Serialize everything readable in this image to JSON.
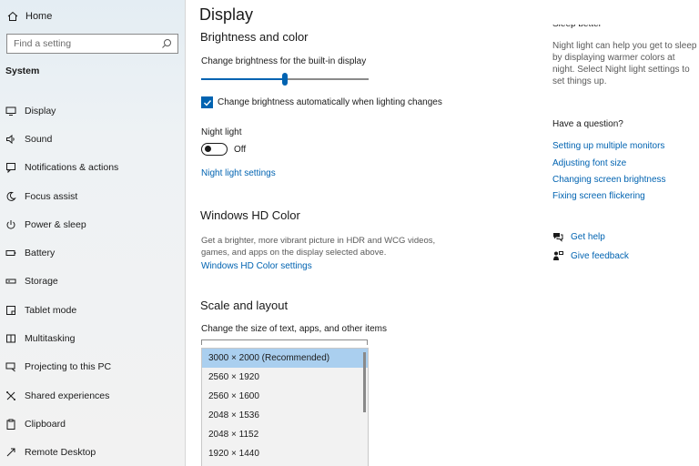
{
  "sidebar": {
    "home_label": "Home",
    "search_placeholder": "Find a setting",
    "section_title": "System",
    "items": [
      {
        "label": "Display",
        "icon": "monitor-icon"
      },
      {
        "label": "Sound",
        "icon": "speaker-icon"
      },
      {
        "label": "Notifications & actions",
        "icon": "notification-icon"
      },
      {
        "label": "Focus assist",
        "icon": "moon-icon"
      },
      {
        "label": "Power & sleep",
        "icon": "power-icon"
      },
      {
        "label": "Battery",
        "icon": "battery-icon"
      },
      {
        "label": "Storage",
        "icon": "storage-icon"
      },
      {
        "label": "Tablet mode",
        "icon": "tablet-icon"
      },
      {
        "label": "Multitasking",
        "icon": "multitasking-icon"
      },
      {
        "label": "Projecting to this PC",
        "icon": "projector-icon"
      },
      {
        "label": "Shared experiences",
        "icon": "shared-icon"
      },
      {
        "label": "Clipboard",
        "icon": "clipboard-icon"
      },
      {
        "label": "Remote Desktop",
        "icon": "remote-icon"
      }
    ]
  },
  "main": {
    "title": "Display",
    "brightness_heading": "Brightness and color",
    "brightness_label": "Change brightness for the built-in display",
    "brightness_value": 0.5,
    "auto_brightness_label": "Change brightness automatically when lighting changes",
    "auto_brightness_checked": true,
    "night_light_label": "Night light",
    "night_light_state": "Off",
    "night_light_settings_link": "Night light settings",
    "hdr_heading": "Windows HD Color",
    "hdr_description": "Get a brighter, more vibrant picture in HDR and WCG videos, games, and apps on the display selected above.",
    "hdr_link": "Windows HD Color settings",
    "scale_heading": "Scale and layout",
    "scale_label": "Change the size of text, apps, and other items",
    "resolution_options": [
      "3000 × 2000 (Recommended)",
      "2560 × 1920",
      "2560 × 1600",
      "2048 × 1536",
      "2048 × 1152",
      "1920 × 1440"
    ],
    "selected_resolution_index": 0
  },
  "aside": {
    "cut_heading": "Sleep better",
    "night_light_para": "Night light can help you get to sleep by displaying warmer colors at night. Select Night light settings to set things up.",
    "question_heading": "Have a question?",
    "links": [
      "Setting up multiple monitors",
      "Adjusting font size",
      "Changing screen brightness",
      "Fixing screen flickering"
    ],
    "get_help": "Get help",
    "give_feedback": "Give feedback"
  },
  "colors": {
    "accent": "#0063b1",
    "selection": "#aacfef"
  }
}
